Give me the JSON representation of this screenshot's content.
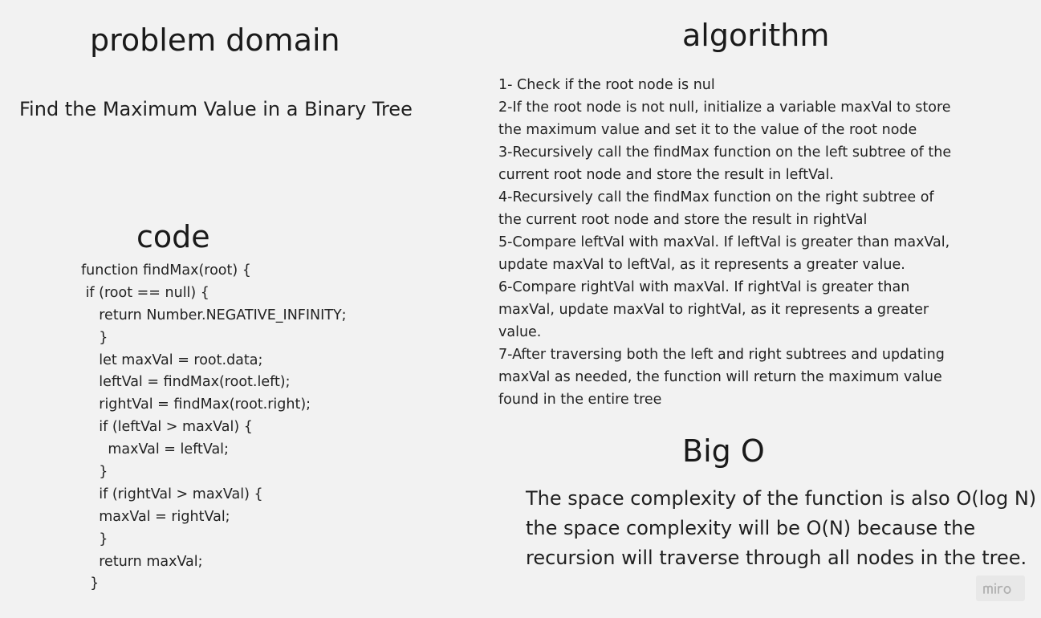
{
  "problem": {
    "heading": "problem domain",
    "text": "Find the Maximum Value in a Binary Tree"
  },
  "algorithm": {
    "heading": "algorithm",
    "lines": [
      " 1- Check if the root node is nul",
      "2-If the root node is not null, initialize a variable maxVal to store",
      "the maximum value and set it to the value of the root node",
      "3-Recursively call the findMax function on the left subtree of the",
      "current root node and store the result in leftVal.",
      "4-Recursively call the findMax function on the right subtree of",
      "the current root node and store the result in rightVal",
      "5-Compare leftVal with maxVal. If leftVal is greater than maxVal,",
      "update maxVal to leftVal, as it represents a greater value.",
      "6-Compare rightVal with maxVal. If rightVal is greater than",
      "maxVal, update maxVal to rightVal, as it represents a greater",
      "value.",
      "7-After traversing both the left and right subtrees and updating",
      "maxVal as needed, the function will return the maximum value",
      "found in the entire tree"
    ]
  },
  "code": {
    "heading": "code",
    "lines": [
      "function findMax(root) {",
      " if (root == null) {",
      "    return Number.NEGATIVE_INFINITY;",
      "    }",
      "    let maxVal = root.data;",
      "    leftVal = findMax(root.left);",
      "    rightVal = findMax(root.right);",
      "    if (leftVal > maxVal) {",
      "      maxVal = leftVal;",
      "    }",
      "    if (rightVal > maxVal) {",
      "    maxVal = rightVal;",
      "    }",
      "    return maxVal;",
      "  }"
    ]
  },
  "bigo": {
    "heading": "Big O",
    "lines": [
      "The space complexity of the function is also O(log N)",
      "the space complexity will be O(N) because the",
      "recursion will traverse through all nodes in the tree."
    ]
  },
  "watermark": {
    "label": "miro",
    "icon": "miro-logo"
  }
}
